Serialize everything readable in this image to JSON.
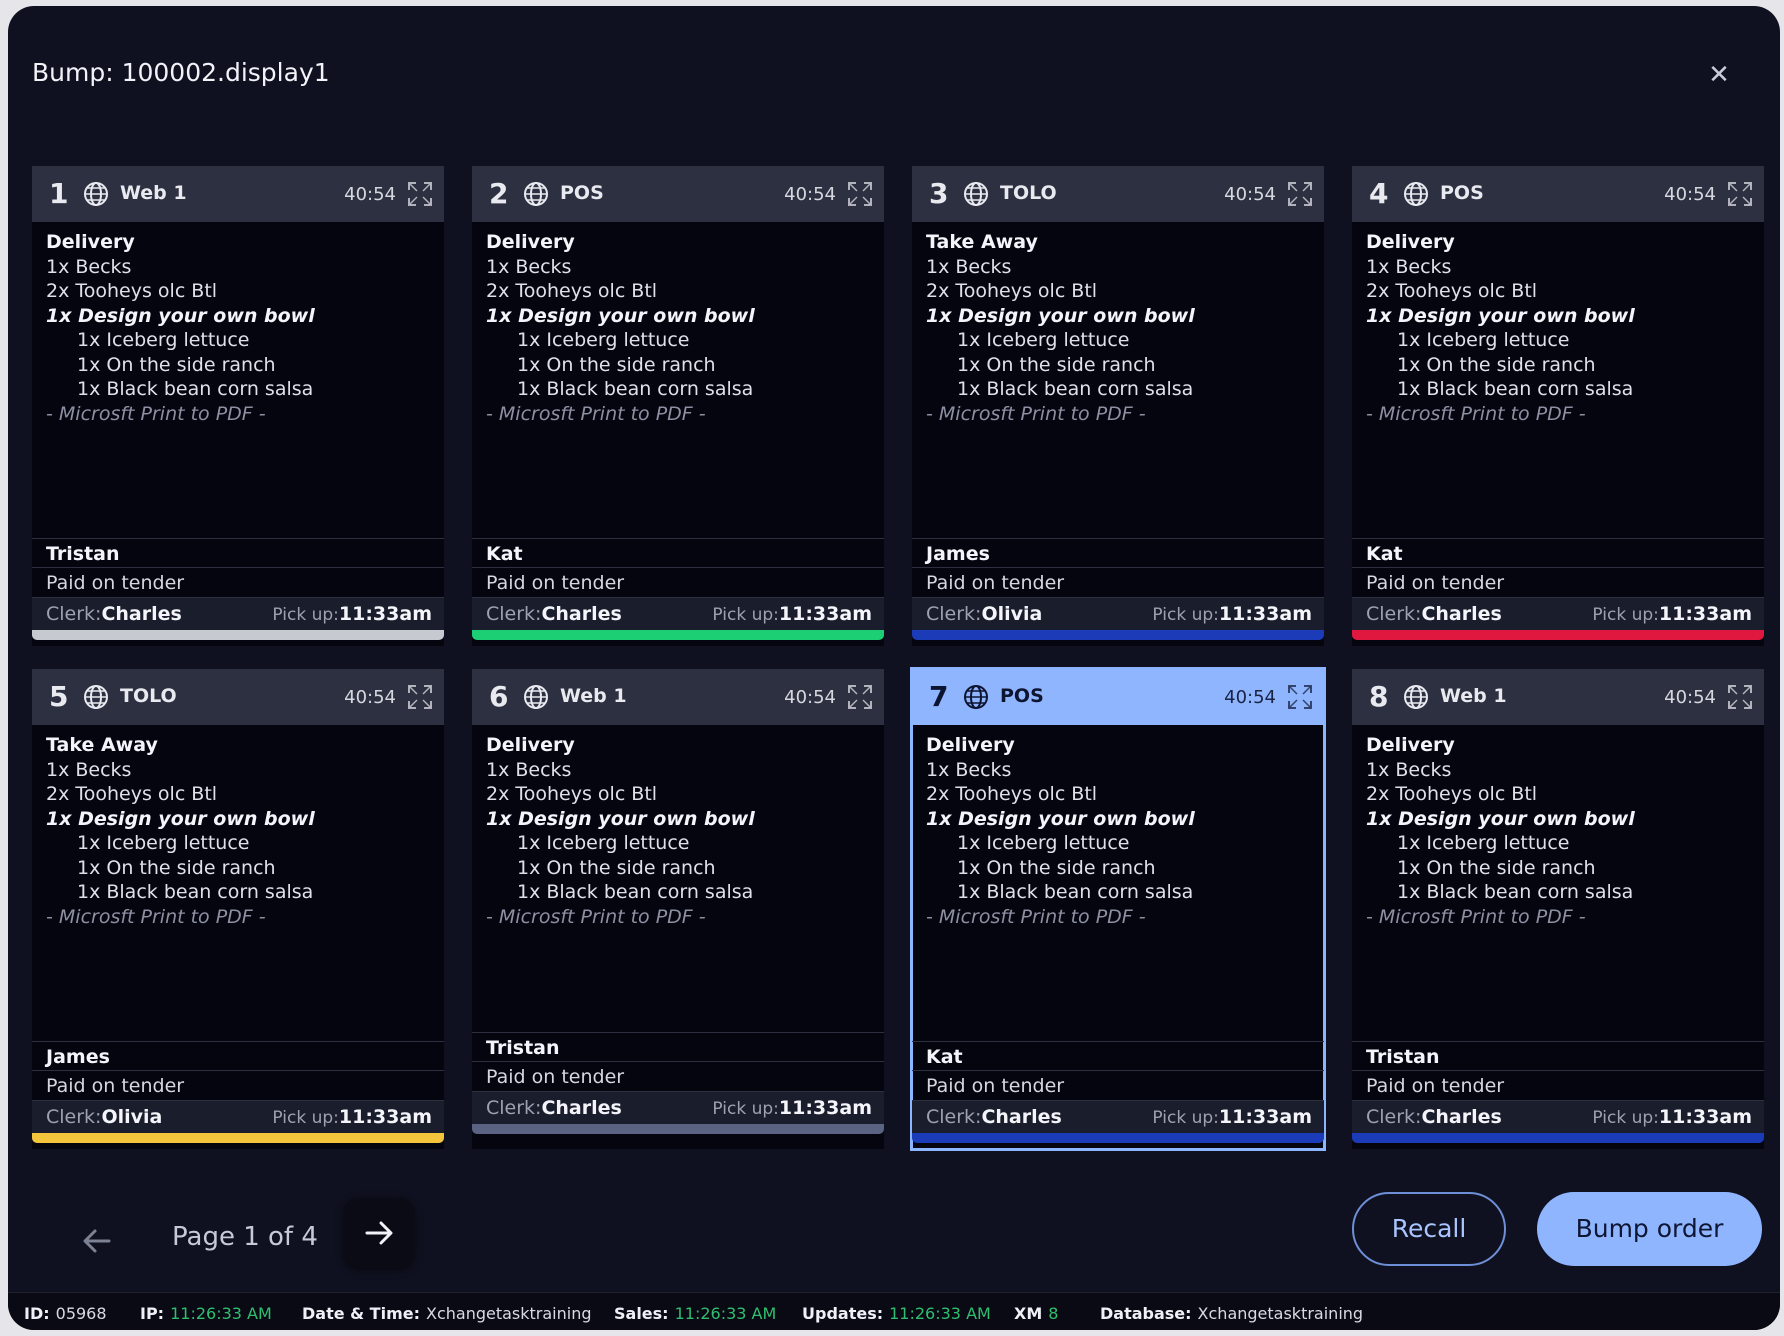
{
  "window": {
    "title": "Bump: 100002.display1",
    "close_icon": "close-icon"
  },
  "orders": [
    {
      "num": "1",
      "source": "Web 1",
      "time": "40:54",
      "type": "Delivery",
      "items": [
        "1x Becks",
        "2x Tooheys olc Btl"
      ],
      "bowl": "1x Design your own bowl",
      "mods": [
        "1x Iceberg lettuce",
        "1x On the side ranch",
        "1x Black bean corn salsa"
      ],
      "printer": "- Microsft Print to PDF -",
      "customer": "Tristan",
      "payment": "Paid on tender",
      "clerk_label": "Clerk:",
      "clerk": "Charles",
      "pickup_label": "Pick up:",
      "pickup": "11:33am",
      "bar_color": "#c7c9d1",
      "selected": false
    },
    {
      "num": "2",
      "source": "POS",
      "time": "40:54",
      "type": "Delivery",
      "items": [
        "1x Becks",
        "2x Tooheys olc Btl"
      ],
      "bowl": "1x Design your own bowl",
      "mods": [
        "1x Iceberg lettuce",
        "1x On the side ranch",
        "1x Black bean corn salsa"
      ],
      "printer": "- Microsft Print to PDF -",
      "customer": "Kat",
      "payment": "Paid on tender",
      "clerk_label": "Clerk:",
      "clerk": "Charles",
      "pickup_label": "Pick up:",
      "pickup": "11:33am",
      "bar_color": "#1ccf74",
      "selected": false
    },
    {
      "num": "3",
      "source": "TOLO",
      "time": "40:54",
      "type": "Take Away",
      "items": [
        "1x Becks",
        "2x Tooheys olc Btl"
      ],
      "bowl": "1x Design your own bowl",
      "mods": [
        "1x Iceberg lettuce",
        "1x On the side ranch",
        "1x Black bean corn salsa"
      ],
      "printer": "- Microsft Print to PDF -",
      "customer": "James",
      "payment": "Paid on tender",
      "clerk_label": "Clerk:",
      "clerk": "Olivia",
      "pickup_label": "Pick up:",
      "pickup": "11:33am",
      "bar_color": "#1c3bb8",
      "selected": false
    },
    {
      "num": "4",
      "source": "POS",
      "time": "40:54",
      "type": "Delivery",
      "items": [
        "1x Becks",
        "2x Tooheys olc Btl"
      ],
      "bowl": "1x Design your own bowl",
      "mods": [
        "1x Iceberg lettuce",
        "1x On the side ranch",
        "1x Black bean corn salsa"
      ],
      "printer": "- Microsft Print to PDF -",
      "customer": "Kat",
      "payment": "Paid on tender",
      "clerk_label": "Clerk:",
      "clerk": "Charles",
      "pickup_label": "Pick up:",
      "pickup": "11:33am",
      "bar_color": "#e0183f",
      "selected": false
    },
    {
      "num": "5",
      "source": "TOLO",
      "time": "40:54",
      "type": "Take Away",
      "items": [
        "1x Becks",
        "2x Tooheys olc Btl"
      ],
      "bowl": "1x Design your own bowl",
      "mods": [
        "1x Iceberg lettuce",
        "1x On the side ranch",
        "1x Black bean corn salsa"
      ],
      "printer": "- Microsft Print to PDF -",
      "customer": "James",
      "payment": "Paid on tender",
      "clerk_label": "Clerk:",
      "clerk": "Olivia",
      "pickup_label": "Pick up:",
      "pickup": "11:33am",
      "bar_color": "#f2c53d",
      "selected": false
    },
    {
      "num": "6",
      "source": "Web 1",
      "time": "40:54",
      "type": "Delivery",
      "items": [
        "1x Becks",
        "2x Tooheys olc Btl"
      ],
      "bowl": "1x Design your own bowl",
      "mods": [
        "1x Iceberg lettuce",
        "1x On the side ranch",
        "1x Black bean corn salsa"
      ],
      "printer": "- Microsft Print to PDF -",
      "customer": "Tristan",
      "payment": "Paid on tender",
      "clerk_label": "Clerk:",
      "clerk": "Charles",
      "pickup_label": "Pick up:",
      "pickup": "11:33am",
      "bar_color": "#5a6482",
      "selected": false
    },
    {
      "num": "7",
      "source": "POS",
      "time": "40:54",
      "type": "Delivery",
      "items": [
        "1x Becks",
        "2x Tooheys olc Btl"
      ],
      "bowl": "1x Design your own bowl",
      "mods": [
        "1x Iceberg lettuce",
        "1x On the side ranch",
        "1x Black bean corn salsa"
      ],
      "printer": "- Microsft Print to PDF -",
      "customer": "Kat",
      "payment": "Paid on tender",
      "clerk_label": "Clerk:",
      "clerk": "Charles",
      "pickup_label": "Pick up:",
      "pickup": "11:33am",
      "bar_color": "#1c3bb8",
      "selected": true
    },
    {
      "num": "8",
      "source": "Web 1",
      "time": "40:54",
      "type": "Delivery",
      "items": [
        "1x Becks",
        "2x Tooheys olc Btl"
      ],
      "bowl": "1x Design your own bowl",
      "mods": [
        "1x Iceberg lettuce",
        "1x On the side ranch",
        "1x Black bean corn salsa"
      ],
      "printer": "- Microsft Print to PDF -",
      "customer": "Tristan",
      "payment": "Paid on tender",
      "clerk_label": "Clerk:",
      "clerk": "Charles",
      "pickup_label": "Pick up:",
      "pickup": "11:33am",
      "bar_color": "#1c3bb8",
      "selected": false
    }
  ],
  "pagination": {
    "label": "Page 1 of 4",
    "prev_icon": "arrow-left-icon",
    "next_icon": "arrow-right-icon"
  },
  "actions": {
    "recall": "Recall",
    "bump": "Bump order"
  },
  "status": {
    "id_label": "ID:",
    "id": "05968",
    "ip_label": "IP:",
    "ip": "11:26:33 AM",
    "datetime_label": "Date & Time:",
    "datetime": "Xchangetasktraining",
    "sales_label": "Sales:",
    "sales": "11:26:33 AM",
    "updates_label": "Updates:",
    "updates": "11:26:33 AM",
    "xm_label": "XM",
    "xm": "8",
    "database_label": "Database:",
    "database": "Xchangetasktraining"
  }
}
